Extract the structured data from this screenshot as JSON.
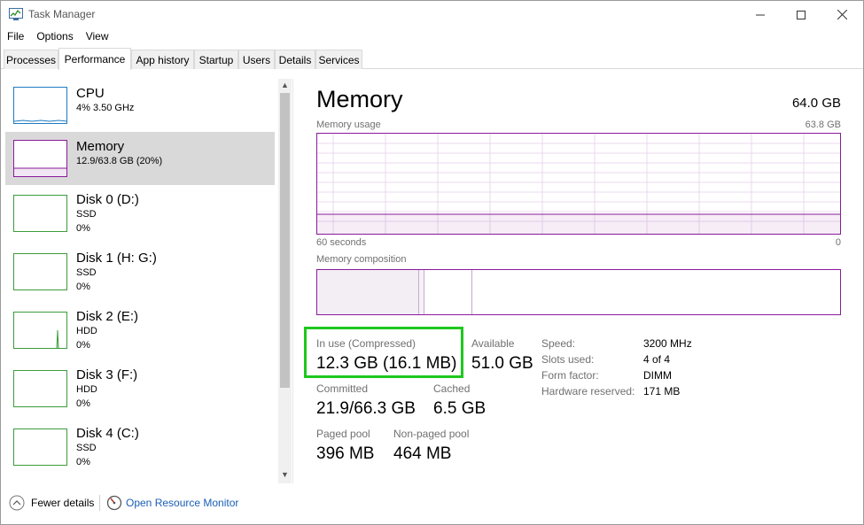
{
  "window": {
    "title": "Task Manager",
    "icons": {
      "app": "task-manager-icon",
      "minimize": "minimize-icon",
      "maximize": "maximize-icon",
      "close": "close-icon"
    }
  },
  "menu": [
    "File",
    "Options",
    "View"
  ],
  "tabs": [
    "Processes",
    "Performance",
    "App history",
    "Startup",
    "Users",
    "Details",
    "Services"
  ],
  "active_tab": "Performance",
  "sidebar": {
    "items": [
      {
        "name": "CPU",
        "detail": "4% 3.50 GHz",
        "selected": false
      },
      {
        "name": "Memory",
        "detail": "12.9/63.8 GB (20%)",
        "selected": true
      },
      {
        "name": "Disk 0 (D:)",
        "type": "SSD",
        "usage": "0%"
      },
      {
        "name": "Disk 1 (H: G:)",
        "type": "SSD",
        "usage": "0%"
      },
      {
        "name": "Disk 2 (E:)",
        "type": "HDD",
        "usage": "0%"
      },
      {
        "name": "Disk 3 (F:)",
        "type": "HDD",
        "usage": "0%"
      },
      {
        "name": "Disk 4 (C:)",
        "type": "SSD",
        "usage": "0%"
      }
    ]
  },
  "memory": {
    "title": "Memory",
    "total": "64.0 GB",
    "usage_label": "Memory usage",
    "usage_max": "63.8 GB",
    "time_left": "60 seconds",
    "time_right": "0",
    "composition_label": "Memory composition",
    "in_use_label": "In use (Compressed)",
    "in_use_value": "12.3 GB (16.1 MB)",
    "available_label": "Available",
    "available_value": "51.0 GB",
    "committed_label": "Committed",
    "committed_value": "21.9/66.3 GB",
    "cached_label": "Cached",
    "cached_value": "6.5 GB",
    "paged_label": "Paged pool",
    "paged_value": "396 MB",
    "nonpaged_label": "Non-paged pool",
    "nonpaged_value": "464 MB",
    "specs": [
      {
        "label": "Speed:",
        "value": "3200 MHz"
      },
      {
        "label": "Slots used:",
        "value": "4 of 4"
      },
      {
        "label": "Form factor:",
        "value": "DIMM"
      },
      {
        "label": "Hardware reserved:",
        "value": "171 MB"
      }
    ]
  },
  "footer": {
    "fewer_details": "Fewer details",
    "resource_monitor": "Open Resource Monitor"
  },
  "colors": {
    "memory": "#8b1a9b",
    "cpu": "#1f7cc0",
    "disk": "#3b9d3b",
    "highlight": "#1ec81e",
    "link": "#1a5fb4"
  }
}
